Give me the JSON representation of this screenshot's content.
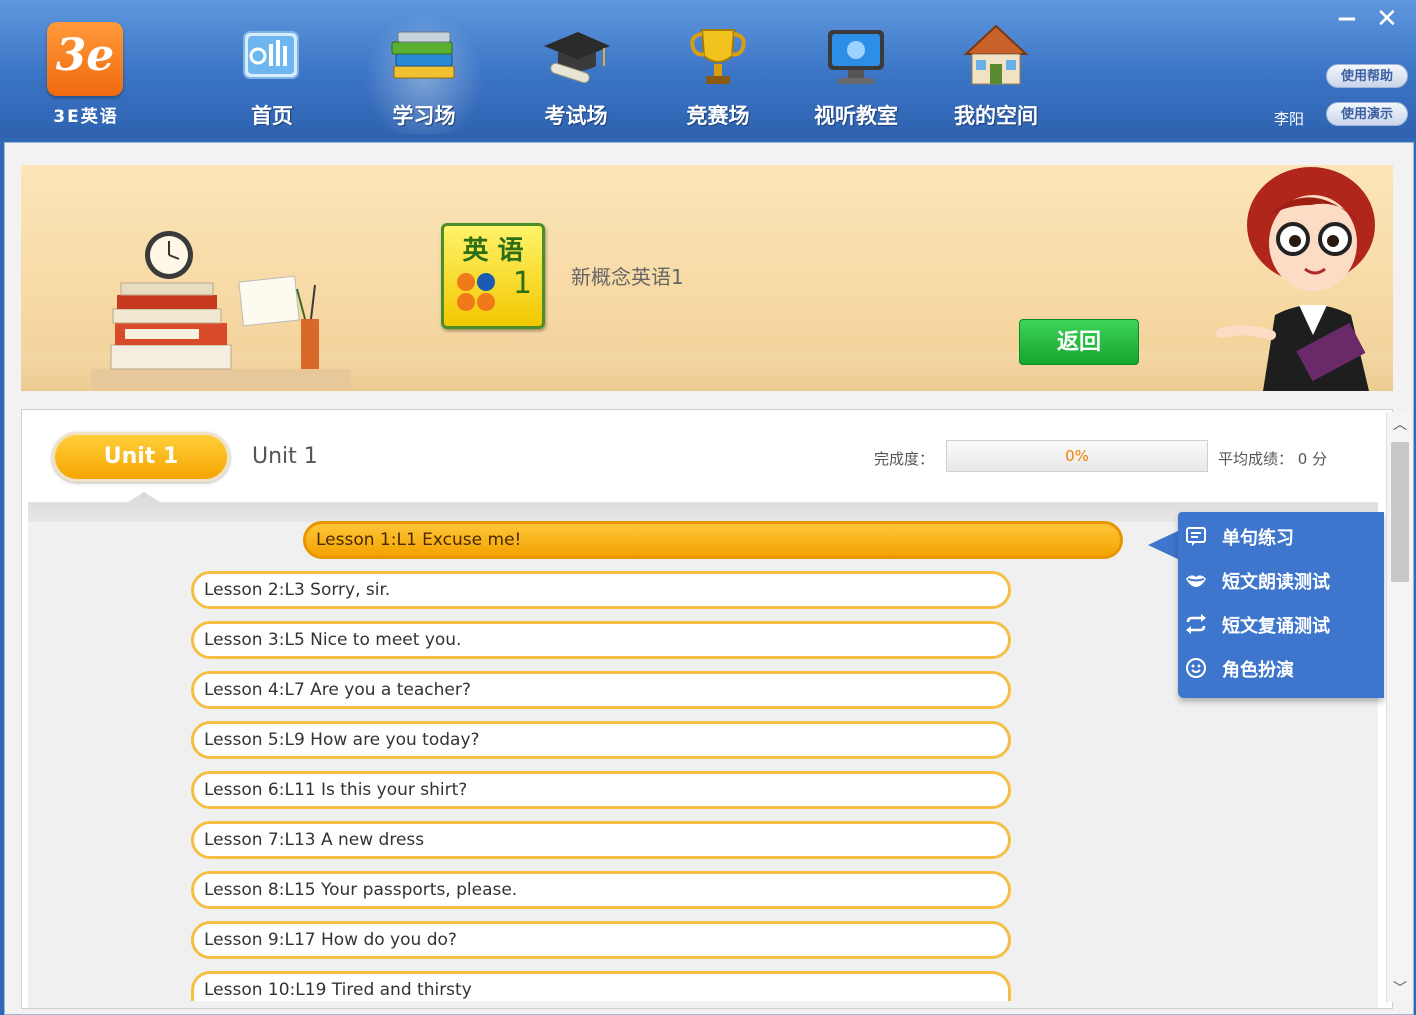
{
  "app": {
    "logo_text": "3e",
    "logo_label": "3E英语"
  },
  "nav": [
    {
      "label": "首页",
      "icon": "home-dashboard-icon"
    },
    {
      "label": "学习场",
      "icon": "books-icon",
      "active": true
    },
    {
      "label": "考试场",
      "icon": "graduation-cap-icon"
    },
    {
      "label": "竞赛场",
      "icon": "trophy-icon"
    },
    {
      "label": "视听教室",
      "icon": "monitor-icon"
    },
    {
      "label": "我的空间",
      "icon": "house-icon"
    }
  ],
  "window": {
    "minimize": "−",
    "close": "✕",
    "help_label": "使用帮助",
    "demo_label": "使用演示",
    "username": "李阳"
  },
  "banner": {
    "cover_title": "英 语",
    "cover_number": "1",
    "book_title": "新概念英语1",
    "back_label": "返回"
  },
  "unit": {
    "pill_label": "Unit 1",
    "title": "Unit 1",
    "progress_label": "完成度：",
    "progress_value": 0,
    "progress_text": "0%",
    "avg_label": "平均成绩： 0 分"
  },
  "lessons": [
    "Lesson 1:L1 Excuse me!",
    "Lesson 2:L3 Sorry, sir.",
    "Lesson 3:L5 Nice to meet you.",
    "Lesson 4:L7 Are you a teacher?",
    "Lesson 5:L9 How are you today?",
    "Lesson 6:L11 Is this your shirt?",
    "Lesson 7:L13 A new dress",
    "Lesson 8:L15 Your passports, please.",
    "Lesson 9:L17 How do you do?",
    "Lesson 10:L19 Tired and thirsty"
  ],
  "popup_menu": [
    {
      "label": "单句练习",
      "icon": "chat-box-icon"
    },
    {
      "label": "短文朗读测试",
      "icon": "lips-icon"
    },
    {
      "label": "短文复诵测试",
      "icon": "repeat-icon"
    },
    {
      "label": "角色扮演",
      "icon": "smiley-icon"
    }
  ],
  "colors": {
    "nav_bg": "#3b74c4",
    "accent_orange": "#f5a400",
    "lesson_border": "#f5be45",
    "back_green": "#14a52f",
    "popup_blue": "#3d76cc"
  }
}
